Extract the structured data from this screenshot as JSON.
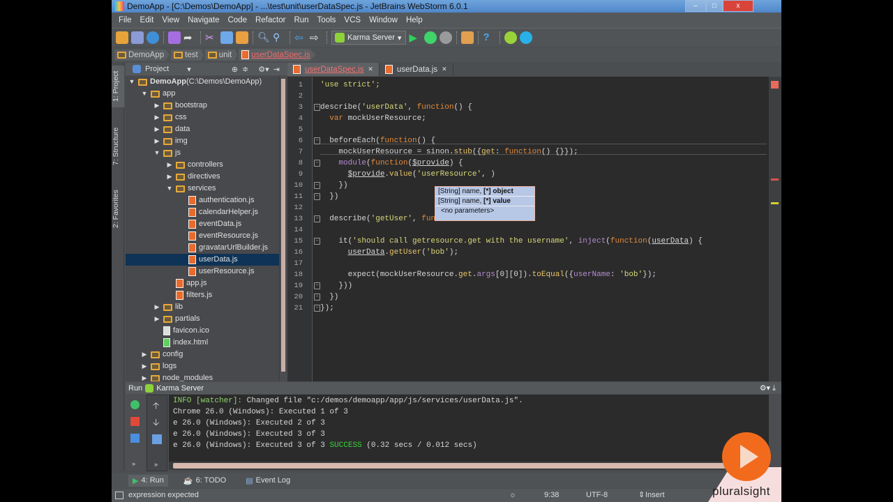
{
  "window": {
    "title": "DemoApp - [C:\\Demos\\DemoApp] - ...\\test\\unit\\userDataSpec.js - JetBrains WebStorm 6.0.1",
    "min": "–",
    "max": "□",
    "close": "x"
  },
  "menu": [
    "File",
    "Edit",
    "View",
    "Navigate",
    "Code",
    "Refactor",
    "Run",
    "Tools",
    "VCS",
    "Window",
    "Help"
  ],
  "toolbar": {
    "run_config": "Karma Server"
  },
  "breadcrumb": [
    "DemoApp",
    "test",
    "unit",
    "userDataSpec.js"
  ],
  "left_strip": {
    "project": "1: Project",
    "structure": "7: Structure",
    "favorites": "2: Favorites"
  },
  "project": {
    "header": "Project",
    "tree": [
      {
        "label": "DemoApp",
        "extra": " (C:\\Demos\\DemoApp)",
        "depth": 0,
        "type": "folder",
        "open": true
      },
      {
        "label": "app",
        "depth": 1,
        "type": "folder",
        "open": true
      },
      {
        "label": "bootstrap",
        "depth": 2,
        "type": "folder",
        "open": false
      },
      {
        "label": "css",
        "depth": 2,
        "type": "folder",
        "open": false
      },
      {
        "label": "data",
        "depth": 2,
        "type": "folder",
        "open": false
      },
      {
        "label": "img",
        "depth": 2,
        "type": "folder",
        "open": false
      },
      {
        "label": "js",
        "depth": 2,
        "type": "folder",
        "open": true
      },
      {
        "label": "controllers",
        "depth": 3,
        "type": "folder",
        "open": false
      },
      {
        "label": "directives",
        "depth": 3,
        "type": "folder",
        "open": false
      },
      {
        "label": "services",
        "depth": 3,
        "type": "folder",
        "open": true
      },
      {
        "label": "authentication.js",
        "depth": 4,
        "type": "js"
      },
      {
        "label": "calendarHelper.js",
        "depth": 4,
        "type": "js"
      },
      {
        "label": "eventData.js",
        "depth": 4,
        "type": "js"
      },
      {
        "label": "eventResource.js",
        "depth": 4,
        "type": "js"
      },
      {
        "label": "gravatarUrlBuilder.js",
        "depth": 4,
        "type": "js"
      },
      {
        "label": "userData.js",
        "depth": 4,
        "type": "js",
        "selected": true
      },
      {
        "label": "userResource.js",
        "depth": 4,
        "type": "js"
      },
      {
        "label": "app.js",
        "depth": 3,
        "type": "js"
      },
      {
        "label": "filters.js",
        "depth": 3,
        "type": "js"
      },
      {
        "label": "lib",
        "depth": 2,
        "type": "folder",
        "open": false
      },
      {
        "label": "partials",
        "depth": 2,
        "type": "folder",
        "open": false
      },
      {
        "label": "favicon.ico",
        "depth": 2,
        "type": "ico"
      },
      {
        "label": "index.html",
        "depth": 2,
        "type": "html"
      },
      {
        "label": "config",
        "depth": 1,
        "type": "folder",
        "open": false
      },
      {
        "label": "logs",
        "depth": 1,
        "type": "folder",
        "open": false
      },
      {
        "label": "node_modules",
        "depth": 1,
        "type": "folder",
        "open": false
      }
    ]
  },
  "editor": {
    "tabs": [
      {
        "label": "userDataSpec.js",
        "active": true
      },
      {
        "label": "userData.js",
        "active": false
      }
    ],
    "lines": [
      [
        [
          "'use strict';",
          "str"
        ]
      ],
      [],
      [
        [
          "describe(",
          ""
        ],
        [
          "'userData'",
          "str"
        ],
        [
          ", ",
          ""
        ],
        [
          "function",
          "kw"
        ],
        [
          "() {",
          ""
        ]
      ],
      [
        [
          "  ",
          ""
        ],
        [
          "var",
          "kw"
        ],
        [
          " mockUserResource;",
          ""
        ]
      ],
      [],
      [
        [
          "  beforeEach(",
          ""
        ],
        [
          "function",
          "kw"
        ],
        [
          "() {",
          ""
        ]
      ],
      [
        [
          "    mockUserResource = sinon.",
          ""
        ],
        [
          "stub",
          "fn"
        ],
        [
          "({",
          ""
        ],
        [
          "get",
          "fn"
        ],
        [
          ": ",
          ""
        ],
        [
          "function",
          "kw"
        ],
        [
          "() {}});",
          ""
        ]
      ],
      [
        [
          "    ",
          ""
        ],
        [
          "module",
          "prop"
        ],
        [
          "(",
          ""
        ],
        [
          "function",
          "kw"
        ],
        [
          "(",
          ""
        ],
        [
          "$provide",
          "u"
        ],
        [
          ") {",
          ""
        ]
      ],
      [
        [
          "      ",
          ""
        ],
        [
          "$provide",
          "u"
        ],
        [
          ".",
          ""
        ],
        [
          "value",
          "fn"
        ],
        [
          "(",
          ""
        ],
        [
          "'userResource'",
          "str"
        ],
        [
          ", )",
          ""
        ]
      ],
      [
        [
          "    })",
          ""
        ]
      ],
      [
        [
          "  })",
          ""
        ]
      ],
      [],
      [
        [
          "  describe(",
          ""
        ],
        [
          "'getUser'",
          "str"
        ],
        [
          ", ",
          ""
        ],
        [
          "fun",
          "kw"
        ]
      ],
      [],
      [
        [
          "    it(",
          ""
        ],
        [
          "'should call getresource.get with the username'",
          "str"
        ],
        [
          ", ",
          ""
        ],
        [
          "inject",
          "prop"
        ],
        [
          "(",
          ""
        ],
        [
          "function",
          "kw"
        ],
        [
          "(",
          ""
        ],
        [
          "userData",
          "u"
        ],
        [
          ") {",
          ""
        ]
      ],
      [
        [
          "      ",
          ""
        ],
        [
          "userData",
          "u"
        ],
        [
          ".",
          ""
        ],
        [
          "getUser",
          "fn"
        ],
        [
          "(",
          ""
        ],
        [
          "'bob'",
          "str"
        ],
        [
          ");",
          ""
        ]
      ],
      [],
      [
        [
          "      expect(mockUserResource.",
          ""
        ],
        [
          "get",
          "fn"
        ],
        [
          ".",
          ""
        ],
        [
          "args",
          "prop"
        ],
        [
          "[0][0]).",
          ""
        ],
        [
          "toEqual",
          "fn"
        ],
        [
          "({",
          ""
        ],
        [
          "userName",
          "prop"
        ],
        [
          ": ",
          ""
        ],
        [
          "'bob'",
          "str"
        ],
        [
          "});",
          ""
        ]
      ],
      [
        [
          "    }))",
          ""
        ]
      ],
      [
        [
          "  })",
          ""
        ]
      ],
      [
        [
          "});",
          ""
        ]
      ]
    ],
    "popup": [
      {
        "a": "[String] name, ",
        "b": "[*] object"
      },
      {
        "a": "[String] name, ",
        "b": "[*] value"
      },
      {
        "a": "<no parameters>",
        "b": ""
      }
    ]
  },
  "run": {
    "label": "Run",
    "config": "Karma Server",
    "output": [
      [
        [
          "INFO [watcher]: ",
          "info"
        ],
        [
          "Changed file \"c:/demos/demoapp/app/js/services/userData.js\".",
          ""
        ]
      ],
      [
        [
          "Chrome 26.0 (Windows): Executed 1 of 3",
          ""
        ]
      ],
      [
        [
          "e 26.0 (Windows): Executed 2 of 3",
          ""
        ]
      ],
      [
        [
          "e 26.0 (Windows): Executed 3 of 3",
          ""
        ]
      ],
      [
        [
          "e 26.0 (Windows): Executed 3 of 3 ",
          ""
        ],
        [
          "SUCCESS",
          "succ"
        ],
        [
          " (0.32 secs / 0.012 secs)",
          ""
        ]
      ]
    ]
  },
  "bottom_tabs": [
    {
      "label": "4: Run",
      "active": true
    },
    {
      "label": "6: TODO"
    },
    {
      "label": "Event Log"
    }
  ],
  "status": {
    "message": "expression expected",
    "position": "9:38",
    "encoding": "UTF-8",
    "mode": "Insert"
  },
  "watermark": {
    "brand": "pluralsight"
  }
}
